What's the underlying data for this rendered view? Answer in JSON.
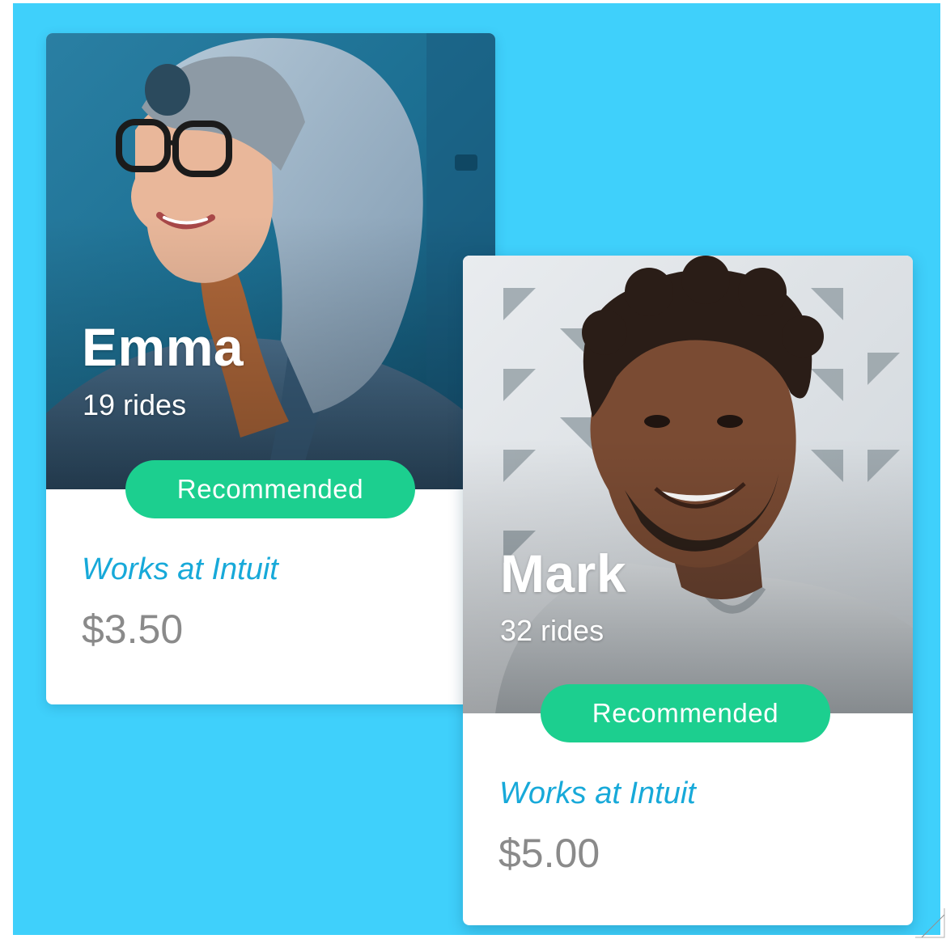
{
  "accent_color": "#3fd0fb",
  "badge_color": "#1ccf8f",
  "link_color": "#17a9d9",
  "price_color": "#8a8a8a",
  "cards": [
    {
      "name": "Emma",
      "rides": "19 rides",
      "badge": "Recommended",
      "employer": "Works at Intuit",
      "price": "$3.50",
      "photo": "woman-in-hoodie-photo"
    },
    {
      "name": "Mark",
      "rides": "32 rides",
      "badge": "Recommended",
      "employer": "Works at Intuit",
      "price": "$5.00",
      "photo": "smiling-man-photo"
    }
  ]
}
